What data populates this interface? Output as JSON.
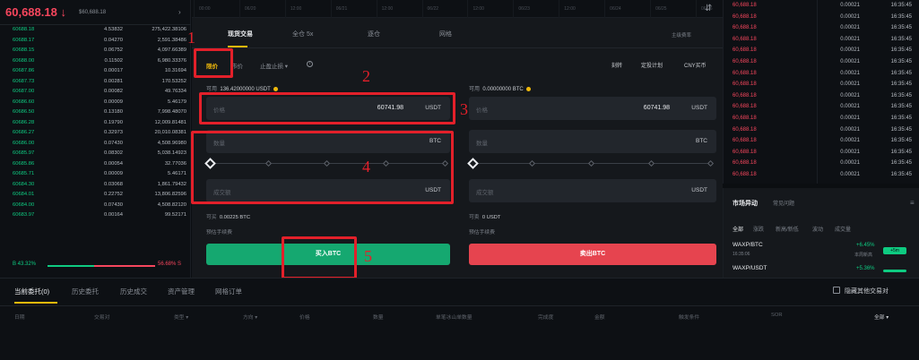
{
  "orderbook": {
    "last_price": "60,688.18",
    "last_price_arrow": "↓",
    "last_price_fiat": "$60,688.18",
    "expand_icon": "chevron-right",
    "rows": [
      {
        "price": "60688.18",
        "amount": "4.53832",
        "total": "275,422.38106"
      },
      {
        "price": "60688.17",
        "amount": "0.04270",
        "total": "2,591.38486"
      },
      {
        "price": "60688.15",
        "amount": "0.06752",
        "total": "4,097.66389"
      },
      {
        "price": "60688.00",
        "amount": "0.11502",
        "total": "6,980.33376"
      },
      {
        "price": "60687.86",
        "amount": "0.00017",
        "total": "10.31694"
      },
      {
        "price": "60687.73",
        "amount": "0.00281",
        "total": "170.53252"
      },
      {
        "price": "60687.00",
        "amount": "0.00082",
        "total": "49.76334"
      },
      {
        "price": "60686.60",
        "amount": "0.00009",
        "total": "5.46179"
      },
      {
        "price": "60686.50",
        "amount": "0.13180",
        "total": "7,998.48070"
      },
      {
        "price": "60686.28",
        "amount": "0.19790",
        "total": "12,009.81481"
      },
      {
        "price": "60686.27",
        "amount": "0.32973",
        "total": "20,010.08381"
      },
      {
        "price": "60686.00",
        "amount": "0.07430",
        "total": "4,508.96980"
      },
      {
        "price": "60685.97",
        "amount": "0.08302",
        "total": "5,038.14923"
      },
      {
        "price": "60685.86",
        "amount": "0.00054",
        "total": "32.77036"
      },
      {
        "price": "60685.71",
        "amount": "0.00009",
        "total": "5.46171"
      },
      {
        "price": "60684.30",
        "amount": "0.03068",
        "total": "1,861.79432"
      },
      {
        "price": "60684.01",
        "amount": "0.22752",
        "total": "13,806.82596"
      },
      {
        "price": "60684.00",
        "amount": "0.07430",
        "total": "4,508.82120"
      },
      {
        "price": "60683.97",
        "amount": "0.00164",
        "total": "99.52171"
      }
    ],
    "ratio_buy": "B 43.32%",
    "ratio_sell": "56.68% S",
    "ratio_buy_fraction": 0.4332
  },
  "timeline": {
    "labels": [
      "00:00",
      "06/20",
      "12:00",
      "06/21",
      "12:00",
      "06/22",
      "12:00",
      "06/23",
      "12:00",
      "06/24",
      "06/25",
      "06/26"
    ],
    "icon": "expand-icon"
  },
  "panel": {
    "tabs": [
      "现货交易",
      "全仓 5x",
      "逐仓",
      "网格"
    ],
    "active_tab": 0,
    "fee_label": "主级费率",
    "order_types": [
      "限价",
      "市价",
      "止盈止损"
    ],
    "right_options": [
      "刻转",
      "定投计划",
      "CNY买币"
    ],
    "buy": {
      "avail_label": "可用",
      "avail_value": "136.42000000 USDT",
      "price_placeholder": "价格",
      "price_value": "60741.98",
      "price_unit": "USDT",
      "amount_placeholder": "数量",
      "amount_unit": "BTC",
      "total_placeholder": "成交额",
      "total_unit": "USDT",
      "can_buy_label": "可买",
      "can_buy_value": "0.00225 BTC",
      "fee_note": "预估手续费",
      "button": "买入BTC"
    },
    "sell": {
      "avail_label": "可用",
      "avail_value": "0.00000000 BTC",
      "price_placeholder": "价格",
      "price_value": "60741.98",
      "price_unit": "USDT",
      "amount_placeholder": "数量",
      "amount_unit": "BTC",
      "total_placeholder": "成交额",
      "total_unit": "USDT",
      "can_sell_label": "可卖",
      "can_sell_value": "0 USDT",
      "fee_note": "预估手续费",
      "button": "卖出BTC"
    }
  },
  "annotations": [
    "1",
    "2",
    "3",
    "4",
    "5"
  ],
  "trades": {
    "rows": [
      {
        "price": "60,688.18",
        "amount": "0.00021",
        "time": "16:35:45"
      },
      {
        "price": "60,688.18",
        "amount": "0.00021",
        "time": "16:35:45"
      },
      {
        "price": "60,688.18",
        "amount": "0.00021",
        "time": "16:35:45"
      },
      {
        "price": "60,688.18",
        "amount": "0.00021",
        "time": "16:35:45"
      },
      {
        "price": "60,688.18",
        "amount": "0.00021",
        "time": "16:35:45"
      },
      {
        "price": "60,688.18",
        "amount": "0.00021",
        "time": "16:35:45"
      },
      {
        "price": "60,688.18",
        "amount": "0.00021",
        "time": "16:35:45"
      },
      {
        "price": "60,688.18",
        "amount": "0.00021",
        "time": "16:35:45"
      },
      {
        "price": "60,688.18",
        "amount": "0.00021",
        "time": "16:35:45"
      },
      {
        "price": "60,688.18",
        "amount": "0.00021",
        "time": "16:35:45"
      },
      {
        "price": "60,688.18",
        "amount": "0.00021",
        "time": "16:35:45"
      },
      {
        "price": "60,688.18",
        "amount": "0.00021",
        "time": "16:35:45"
      },
      {
        "price": "60,688.18",
        "amount": "0.00021",
        "time": "16:35:45"
      },
      {
        "price": "60,688.18",
        "amount": "0.00021",
        "time": "16:35:45"
      },
      {
        "price": "60,688.18",
        "amount": "0.00021",
        "time": "16:35:45"
      },
      {
        "price": "60,688.18",
        "amount": "0.00021",
        "time": "16:35:45"
      }
    ]
  },
  "market": {
    "title": "市场异动",
    "link": "常见问题",
    "tabs": [
      "全部",
      "涨跌",
      "新高/新低",
      "波动",
      "成交量"
    ],
    "items": [
      {
        "pair": "WAXP/BTC",
        "sub": "16:35:06",
        "sub2": "本周新高",
        "pct": "+6.45%",
        "pill": "+5m"
      },
      {
        "pair": "WAXP/USDT",
        "sub": "",
        "sub2": "",
        "pct": "+5.36%",
        "pill": ""
      }
    ]
  },
  "bottom": {
    "tabs": [
      "当前委托(0)",
      "历史委托",
      "历史成交",
      "资产管理",
      "网格订单"
    ],
    "hide_label": "隐藏其他交易对",
    "columns": [
      "日期",
      "交易对",
      "类型",
      "方向",
      "价格",
      "数量",
      "单笔冰山单数量",
      "完成度",
      "金额",
      "触发条件",
      "SOR",
      "全部"
    ]
  },
  "colors": {
    "buy_green": "#15a870",
    "sell_red": "#e6444f",
    "accent_yellow": "#f0b90b",
    "annotation_red": "#e3202a"
  }
}
